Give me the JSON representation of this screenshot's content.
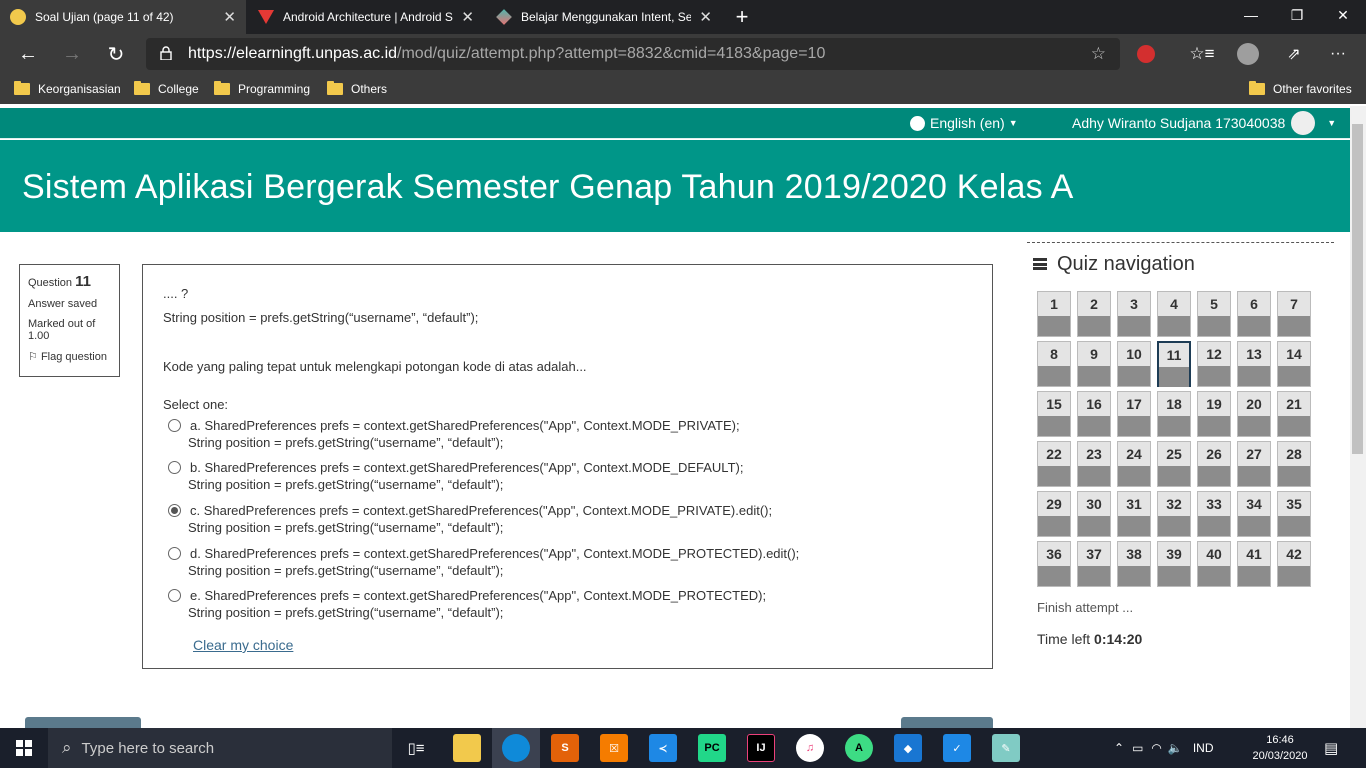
{
  "browser": {
    "tabs": [
      {
        "title": "Soal Ujian (page 11 of 42)",
        "active": true
      },
      {
        "title": "Android Architecture | Android S",
        "active": false
      },
      {
        "title": "Belajar Menggunakan Intent, Sel",
        "active": false
      }
    ],
    "url_host": "https://elearningft.unpas.ac.id",
    "url_path": "/mod/quiz/attempt.php?attempt=8832&cmid=4183&page=10",
    "bookmarks": [
      "Keorganisasian",
      "College",
      "Programming",
      "Others"
    ],
    "other_favorites": "Other favorites"
  },
  "topnav": {
    "language": "English (en)",
    "user": "Adhy Wiranto Sudjana 173040038"
  },
  "course_title": "Sistem Aplikasi Bergerak Semester Genap Tahun 2019/2020 Kelas A",
  "question_info": {
    "label": "Question",
    "number": "11",
    "status": "Answer saved",
    "marked": "Marked out of 1.00",
    "flag": "Flag question"
  },
  "question": {
    "line1": ".... ?",
    "line2": "String position = prefs.getString(“username”, “default”);",
    "prompt": "Kode yang paling tepat untuk melengkapi potongan kode di atas adalah...",
    "select_one": "Select one:",
    "options": [
      {
        "l1": "a. SharedPreferences prefs = context.getSharedPreferences(\"App\", Context.MODE_PRIVATE);",
        "l2": "String position = prefs.getString(“username”, “default”);",
        "selected": false
      },
      {
        "l1": "b. SharedPreferences prefs = context.getSharedPreferences(\"App\", Context.MODE_DEFAULT);",
        "l2": "String position = prefs.getString(“username”, “default”);",
        "selected": false
      },
      {
        "l1": "c. SharedPreferences prefs = context.getSharedPreferences(\"App\", Context.MODE_PRIVATE).edit();",
        "l2": "String position = prefs.getString(“username”, “default”);",
        "selected": true
      },
      {
        "l1": "d. SharedPreferences prefs = context.getSharedPreferences(\"App\", Context.MODE_PROTECTED).edit();",
        "l2": "String position = prefs.getString(“username”, “default”);",
        "selected": false
      },
      {
        "l1": "e. SharedPreferences prefs = context.getSharedPreferences(\"App\", Context.MODE_PROTECTED);",
        "l2": "String position = prefs.getString(“username”, “default”);",
        "selected": false
      }
    ],
    "clear": "Clear my choice"
  },
  "quiz_nav": {
    "title": "Quiz navigation",
    "current": 11,
    "numbers": [
      "1",
      "2",
      "3",
      "4",
      "5",
      "6",
      "7",
      "8",
      "9",
      "10",
      "11",
      "12",
      "13",
      "14",
      "15",
      "16",
      "17",
      "18",
      "19",
      "20",
      "21",
      "22",
      "23",
      "24",
      "25",
      "26",
      "27",
      "28",
      "29",
      "30",
      "31",
      "32",
      "33",
      "34",
      "35",
      "36",
      "37",
      "38",
      "39",
      "40",
      "41",
      "42"
    ],
    "finish": "Finish attempt ...",
    "time_label": "Time left",
    "time_value": "0:14:20"
  },
  "taskbar": {
    "search_placeholder": "Type here to search",
    "lang": "IND",
    "time": "16:46",
    "date": "20/03/2020"
  },
  "colors": {
    "moodle_teal": "#009688",
    "nav_teal": "#00897b",
    "answered_gray": "#8c8c8c"
  }
}
